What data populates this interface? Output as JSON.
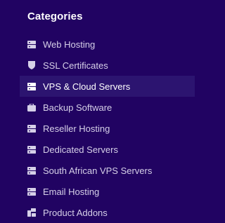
{
  "sidebar": {
    "heading": "Categories",
    "items": [
      {
        "label": "Web Hosting",
        "icon": "server-icon",
        "active": false
      },
      {
        "label": "SSL Certificates",
        "icon": "shield-icon",
        "active": false
      },
      {
        "label": "VPS & Cloud Servers",
        "icon": "server-icon",
        "active": true
      },
      {
        "label": "Backup Software",
        "icon": "briefcase-icon",
        "active": false
      },
      {
        "label": "Reseller Hosting",
        "icon": "server-icon",
        "active": false
      },
      {
        "label": "Dedicated Servers",
        "icon": "server-icon",
        "active": false
      },
      {
        "label": "South African VPS Servers",
        "icon": "server-icon",
        "active": false
      },
      {
        "label": "Email Hosting",
        "icon": "server-icon",
        "active": false
      },
      {
        "label": "Product Addons",
        "icon": "cubes-icon",
        "active": false
      }
    ]
  },
  "colors": {
    "background": "#210362",
    "active_background": "#2c1470",
    "heading": "#ffffff",
    "item_text": "#d6d0e8"
  }
}
